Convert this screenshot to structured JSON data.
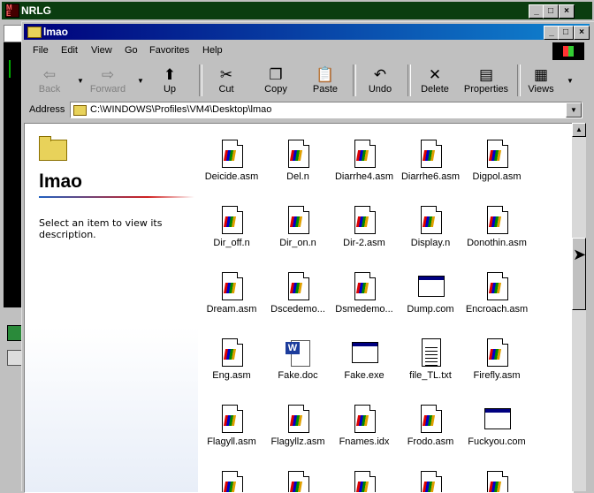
{
  "background_window": {
    "title": "NRLG",
    "icon": "nrlg-app-icon",
    "controls": [
      "_",
      "□",
      "×"
    ]
  },
  "window": {
    "title": "lmao",
    "controls": [
      "_",
      "□",
      "×"
    ],
    "title_gradient": [
      "#00007b",
      "#1084d0"
    ]
  },
  "menubar": {
    "items": [
      {
        "label": "File"
      },
      {
        "label": "Edit"
      },
      {
        "label": "View"
      },
      {
        "label": "Go"
      },
      {
        "label": "Favorites"
      },
      {
        "label": "Help"
      }
    ]
  },
  "toolbar": {
    "buttons": [
      {
        "label": "Back",
        "icon": "back-arrow-icon",
        "enabled": false,
        "glyph": "⇦"
      },
      {
        "label": "Forward",
        "icon": "forward-arrow-icon",
        "enabled": false,
        "glyph": "⇨"
      },
      {
        "label": "Up",
        "icon": "up-folder-icon",
        "enabled": true,
        "glyph": "⬆"
      },
      {
        "label": "Cut",
        "icon": "scissors-icon",
        "enabled": true,
        "glyph": "✂"
      },
      {
        "label": "Copy",
        "icon": "copy-icon",
        "enabled": true,
        "glyph": "❐"
      },
      {
        "label": "Paste",
        "icon": "paste-icon",
        "enabled": true,
        "glyph": "📋"
      },
      {
        "label": "Undo",
        "icon": "undo-icon",
        "enabled": true,
        "glyph": "↶"
      },
      {
        "label": "Delete",
        "icon": "delete-x-icon",
        "enabled": true,
        "glyph": "✕"
      },
      {
        "label": "Properties",
        "icon": "properties-icon",
        "enabled": true,
        "glyph": "▤"
      },
      {
        "label": "Views",
        "icon": "views-icon",
        "enabled": true,
        "glyph": "▦"
      }
    ]
  },
  "address": {
    "label": "Address",
    "value": "C:\\WINDOWS\\Profiles\\VM4\\Desktop\\lmao"
  },
  "left_pane": {
    "folder_name": "lmao",
    "description": "Select an item to view its description."
  },
  "files": [
    {
      "name": "Deicide.asm",
      "type": "asm"
    },
    {
      "name": "Del.n",
      "type": "asm"
    },
    {
      "name": "Diarrhe4.asm",
      "type": "asm"
    },
    {
      "name": "Diarrhe6.asm",
      "type": "asm"
    },
    {
      "name": "Digpol.asm",
      "type": "asm"
    },
    {
      "name": "Dir_off.n",
      "type": "asm"
    },
    {
      "name": "Dir_on.n",
      "type": "asm"
    },
    {
      "name": "Dir-2.asm",
      "type": "asm"
    },
    {
      "name": "Display.n",
      "type": "asm"
    },
    {
      "name": "Donothin.asm",
      "type": "asm"
    },
    {
      "name": "Dream.asm",
      "type": "asm"
    },
    {
      "name": "Dscedemo...",
      "type": "asm"
    },
    {
      "name": "Dsmedemo...",
      "type": "asm"
    },
    {
      "name": "Dump.com",
      "type": "exe"
    },
    {
      "name": "Encroach.asm",
      "type": "asm"
    },
    {
      "name": "Eng.asm",
      "type": "asm"
    },
    {
      "name": "Fake.doc",
      "type": "doc"
    },
    {
      "name": "Fake.exe",
      "type": "exe"
    },
    {
      "name": "file_TL.txt",
      "type": "txt"
    },
    {
      "name": "Firefly.asm",
      "type": "asm"
    },
    {
      "name": "Flagyll.asm",
      "type": "asm"
    },
    {
      "name": "Flagyllz.asm",
      "type": "asm"
    },
    {
      "name": "Fnames.idx",
      "type": "asm"
    },
    {
      "name": "Frodo.asm",
      "type": "asm"
    },
    {
      "name": "Fuckyou.com",
      "type": "exe"
    },
    {
      "name": "",
      "type": "asm"
    },
    {
      "name": "",
      "type": "asm"
    },
    {
      "name": "",
      "type": "asm"
    },
    {
      "name": "",
      "type": "asm"
    },
    {
      "name": "",
      "type": "asm"
    }
  ]
}
